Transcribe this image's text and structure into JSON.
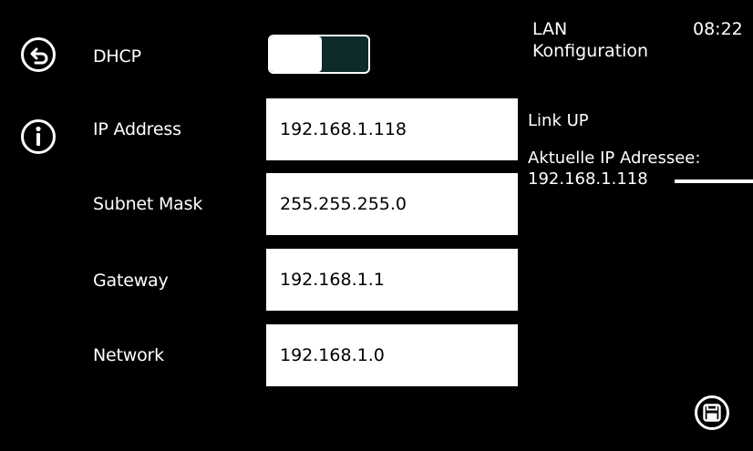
{
  "header": {
    "title_line1": "LAN",
    "title_line2": "Konfiguration",
    "time": "08:22"
  },
  "dhcp": {
    "label": "DHCP",
    "state": "on"
  },
  "fields": [
    {
      "label": "IP Address",
      "value": "192.168.1.118"
    },
    {
      "label": "Subnet Mask",
      "value": "255.255.255.0"
    },
    {
      "label": "Gateway",
      "value": "192.168.1.1"
    },
    {
      "label": "Network",
      "value": "192.168.1.0"
    }
  ],
  "status": {
    "link": "Link UP",
    "current_ip_label": "Aktuelle IP Adressee:",
    "current_ip_value": "192.168.1.118"
  },
  "icons": {
    "back": "back-arrow-icon",
    "info": "info-icon",
    "save": "save-floppy-icon"
  },
  "colors": {
    "background": "#000000",
    "text": "#ffffff",
    "field_bg": "#ffffff",
    "toggle_off": "#0e2a2a"
  }
}
